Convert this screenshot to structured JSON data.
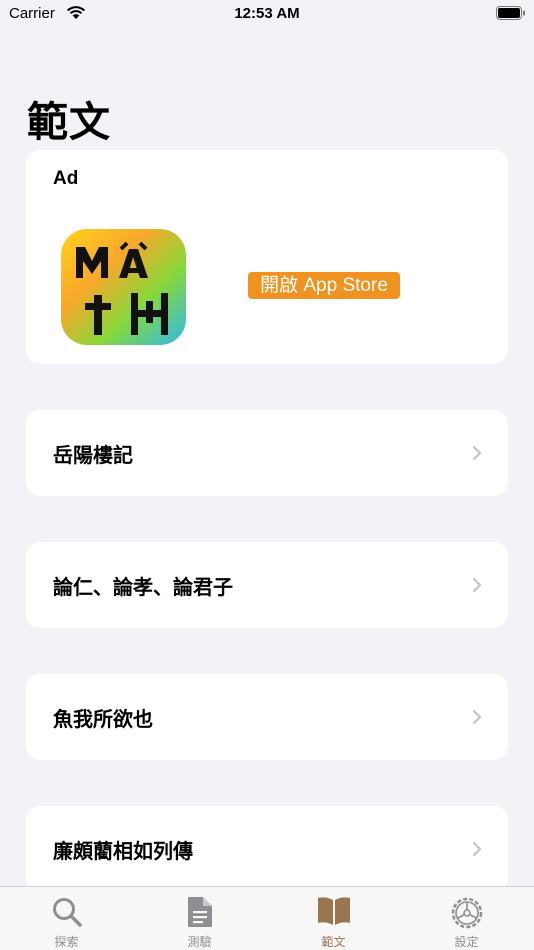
{
  "status_bar": {
    "carrier": "Carrier",
    "time": "12:53 AM"
  },
  "page": {
    "title": "範文"
  },
  "ad": {
    "label": "Ad",
    "cta": "開啟 App Store"
  },
  "list": {
    "items": [
      {
        "label": "岳陽樓記"
      },
      {
        "label": "論仁、論孝、論君子"
      },
      {
        "label": "魚我所欲也"
      },
      {
        "label": "廉頗藺相如列傳"
      }
    ]
  },
  "tab_bar": {
    "tabs": [
      {
        "label": "探索",
        "icon": "search-icon",
        "active": false
      },
      {
        "label": "測驗",
        "icon": "document-icon",
        "active": false
      },
      {
        "label": "範文",
        "icon": "book-icon",
        "active": true
      },
      {
        "label": "設定",
        "icon": "gear-icon",
        "active": false
      }
    ],
    "active_color": "#9a7650",
    "inactive_color": "#8e8e93"
  },
  "colors": {
    "background": "#f2f2f7",
    "cta": "#f0921f"
  }
}
